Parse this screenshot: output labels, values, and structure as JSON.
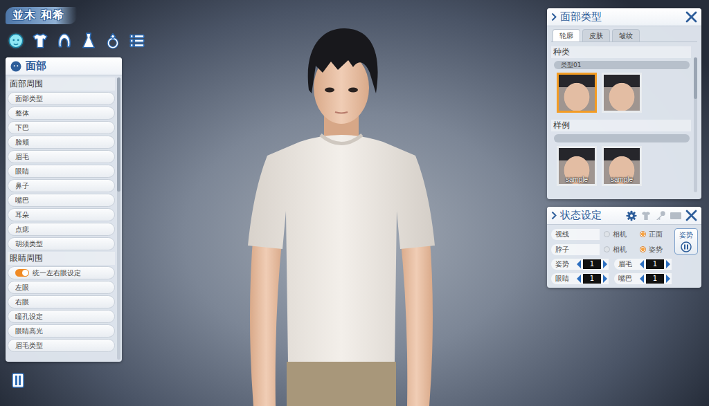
{
  "character_name": "並木 和希",
  "category_tabs": [
    {
      "selected": true
    },
    {
      "selected": false
    },
    {
      "selected": false
    },
    {
      "selected": false
    },
    {
      "selected": false
    },
    {
      "selected": false
    }
  ],
  "left_panel": {
    "title": "面部",
    "sections": [
      {
        "title": "面部周围",
        "items": [
          {
            "label": "面部类型",
            "kind": "button"
          },
          {
            "label": "整体",
            "kind": "button"
          },
          {
            "label": "下巴",
            "kind": "button"
          },
          {
            "label": "脸颊",
            "kind": "button"
          },
          {
            "label": "眉毛",
            "kind": "button"
          },
          {
            "label": "眼睛",
            "kind": "button"
          },
          {
            "label": "鼻子",
            "kind": "button"
          },
          {
            "label": "嘴巴",
            "kind": "button"
          },
          {
            "label": "耳朵",
            "kind": "button"
          },
          {
            "label": "点痣",
            "kind": "button"
          },
          {
            "label": "胡须类型",
            "kind": "button"
          }
        ]
      },
      {
        "title": "眼睛周围",
        "items": [
          {
            "label": "统一左右眼设定",
            "kind": "toggle",
            "on": true
          },
          {
            "label": "左眼",
            "kind": "button"
          },
          {
            "label": "右眼",
            "kind": "button"
          },
          {
            "label": "瞳孔设定",
            "kind": "button"
          },
          {
            "label": "眼睛高光",
            "kind": "button"
          },
          {
            "label": "眉毛类型",
            "kind": "button"
          }
        ]
      }
    ]
  },
  "face_type_panel": {
    "title": "面部类型",
    "tabs": [
      {
        "label": "轮廓",
        "selected": true
      },
      {
        "label": "皮肤",
        "selected": false
      },
      {
        "label": "皱纹",
        "selected": false
      }
    ],
    "type_section": {
      "title": "种类",
      "current": "类型01",
      "options": [
        {
          "selected": true
        },
        {
          "selected": false
        }
      ]
    },
    "sample_section": {
      "title": "样例",
      "options": [
        {
          "label": "sample"
        },
        {
          "label": "sample"
        }
      ]
    }
  },
  "status_panel": {
    "title": "状态设定",
    "radio_rows": [
      {
        "label": "视线",
        "options": [
          {
            "label": "相机",
            "selected": false
          },
          {
            "label": "正面",
            "selected": true
          }
        ]
      },
      {
        "label": "脖子",
        "options": [
          {
            "label": "相机",
            "selected": false
          },
          {
            "label": "姿势",
            "selected": true
          }
        ]
      }
    ],
    "pose_button": {
      "label": "姿势"
    },
    "steppers": [
      {
        "label": "姿势",
        "value": "1"
      },
      {
        "label": "眉毛",
        "value": "1"
      },
      {
        "label": "眼睛",
        "value": "1"
      },
      {
        "label": "嘴巴",
        "value": "1"
      }
    ]
  }
}
